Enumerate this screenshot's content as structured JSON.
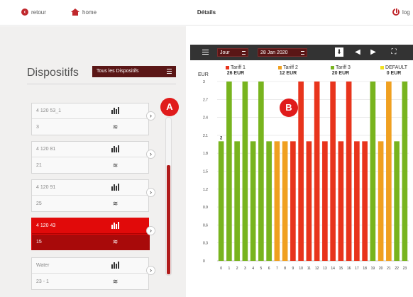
{
  "header": {
    "back_label": "retour",
    "home_label": "home",
    "title": "Détails",
    "logout_label": "log"
  },
  "left": {
    "title": "Dispositifs",
    "filter_label": "Tous les Dispositifs",
    "devices": [
      {
        "name": "4 120 53_1",
        "value": "3"
      },
      {
        "name": "4 120 81",
        "value": "21"
      },
      {
        "name": "4 120 91",
        "value": "25"
      },
      {
        "name": "4 120 43",
        "value": "15"
      },
      {
        "name": "Water",
        "value": "23 - 1"
      }
    ],
    "scroll_fraction": 0.3
  },
  "badges": {
    "a": "A",
    "b": "B"
  },
  "toolbar": {
    "period": "Jour",
    "date": "28 Jan 2020"
  },
  "colors": {
    "tariff1": "#e8341c",
    "tariff2": "#f0a020",
    "tariff3": "#78b41e",
    "default": "#f0e020",
    "accent": "#c0282d"
  },
  "chart_data": {
    "type": "bar",
    "ylabel": "EUR",
    "ylim": [
      0,
      3
    ],
    "yticks": [
      "0",
      "0.3",
      "0.6",
      "0.9",
      "1.2",
      "1.5",
      "1.8",
      "2.1",
      "2.4",
      "2.7",
      "3"
    ],
    "categories": [
      "0",
      "1",
      "2",
      "3",
      "4",
      "5",
      "6",
      "7",
      "8",
      "9",
      "10",
      "11",
      "12",
      "13",
      "14",
      "15",
      "16",
      "17",
      "18",
      "19",
      "20",
      "21",
      "22",
      "23"
    ],
    "values": [
      2,
      3,
      2,
      3,
      2,
      3,
      2,
      2,
      2,
      2,
      3,
      2,
      3,
      2,
      3,
      2,
      3,
      2,
      2,
      3,
      2,
      3,
      2,
      3
    ],
    "tariffs": [
      "tariff3",
      "tariff3",
      "tariff3",
      "tariff3",
      "tariff3",
      "tariff3",
      "tariff3",
      "tariff2",
      "tariff2",
      "tariff1",
      "tariff1",
      "tariff1",
      "tariff1",
      "tariff1",
      "tariff1",
      "tariff1",
      "tariff1",
      "tariff1",
      "tariff1",
      "tariff3",
      "tariff2",
      "tariff2",
      "tariff3",
      "tariff3"
    ],
    "data_label": "2",
    "legend": [
      {
        "name": "Tariff 1",
        "value": "26 EUR",
        "key": "tariff1"
      },
      {
        "name": "Tariff 2",
        "value": "12 EUR",
        "key": "tariff2"
      },
      {
        "name": "Tariff 3",
        "value": "20 EUR",
        "key": "tariff3"
      },
      {
        "name": "DEFAULT",
        "value": "0 EUR",
        "key": "default"
      }
    ],
    "grid": true
  }
}
